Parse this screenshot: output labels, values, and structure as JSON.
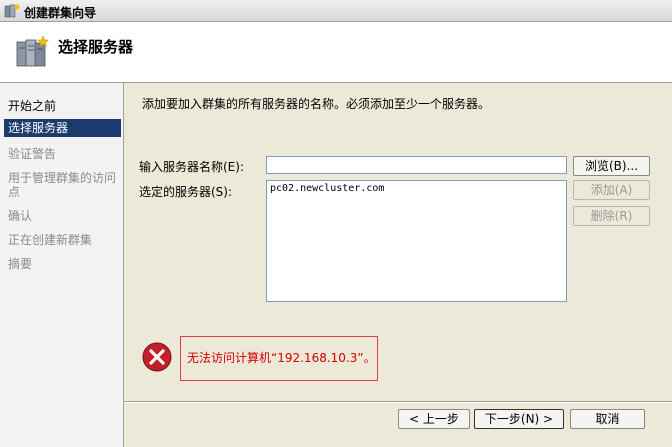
{
  "window": {
    "title": "创建群集向导"
  },
  "header": {
    "title": "选择服务器"
  },
  "sidebar": {
    "items": [
      {
        "label": "开始之前",
        "state": "done"
      },
      {
        "label": "选择服务器",
        "state": "active"
      },
      {
        "label": "验证警告",
        "state": "pending"
      },
      {
        "label": "用于管理群集的访问点",
        "state": "pending"
      },
      {
        "label": "确认",
        "state": "pending"
      },
      {
        "label": "正在创建新群集",
        "state": "pending"
      },
      {
        "label": "摘要",
        "state": "pending"
      }
    ]
  },
  "main": {
    "instruction": "添加要加入群集的所有服务器的名称。必须添加至少一个服务器。",
    "server_name_label": "输入服务器名称(E):",
    "server_name_value": "",
    "selected_label": "选定的服务器(S):",
    "selected_servers": [
      "pc02.newcluster.com"
    ],
    "browse_button": "浏览(B)...",
    "add_button": "添加(A)",
    "remove_button": "删除(R)",
    "error_message": "无法访问计算机“192.168.10.3”。"
  },
  "footer": {
    "back_button": "< 上一步",
    "next_button": "下一步(N) >",
    "cancel_button": "取消"
  },
  "colors": {
    "active_nav": "#1c3a6e",
    "error_text": "#d00000",
    "error_icon": "#c0202a"
  }
}
